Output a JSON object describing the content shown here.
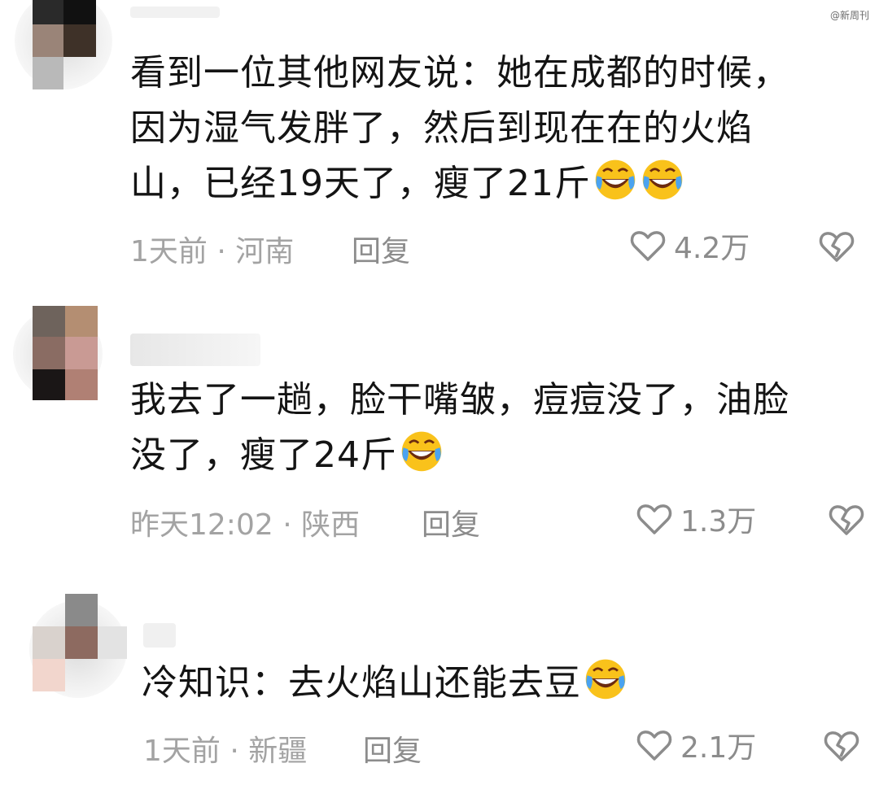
{
  "watermark": "@新周刊",
  "comments": [
    {
      "text_lines": [
        "看到一位其他网友说：她在成都的时候，",
        "因为湿气发胖了，然后到现在在的火焰",
        "山，已经19天了，瘦了21斤"
      ],
      "emojis": [
        "laughing-crying-emoji",
        "laughing-crying-emoji"
      ],
      "meta": "1天前 · 河南",
      "reply_label": "回复",
      "likes": "4.2万"
    },
    {
      "text_lines": [
        "我去了一趟，脸干嘴皱，痘痘没了，油脸",
        "没了，瘦了24斤"
      ],
      "emojis": [
        "laughing-crying-emoji"
      ],
      "meta": "昨天12:02 · 陕西",
      "reply_label": "回复",
      "likes": "1.3万"
    },
    {
      "text_lines": [
        "冷知识：去火焰山还能去豆"
      ],
      "emojis": [
        "laughing-crying-emoji"
      ],
      "meta": "1天前 · 新疆",
      "reply_label": "回复",
      "likes": "2.1万"
    }
  ],
  "colors": {
    "text": "#141414",
    "meta": "#a3a3a3",
    "action": "#8c8c8c",
    "emoji_face": "#f9c21b"
  }
}
